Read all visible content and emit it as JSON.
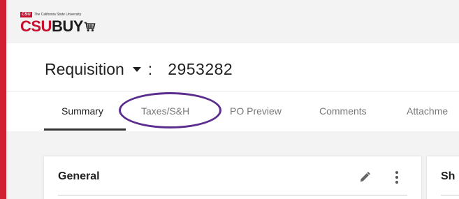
{
  "brand": {
    "badge": "CSU",
    "tagline": "The California State University",
    "name_red": "CSU",
    "name_dark": "BUY",
    "cart_icon": "shopping-cart-icon",
    "accent_color": "#c8102e"
  },
  "header": {
    "doc_type": "Requisition",
    "separator": ":",
    "doc_number": "2953282"
  },
  "tabs": [
    {
      "label": "Summary",
      "active": true
    },
    {
      "label": "Taxes/S&H",
      "active": false,
      "highlighted": true,
      "highlight_color": "#5b2d8e"
    },
    {
      "label": "PO Preview",
      "active": false
    },
    {
      "label": "Comments",
      "active": false
    },
    {
      "label": "Attachme",
      "active": false
    }
  ],
  "cards": [
    {
      "title": "General",
      "actions": [
        "pencil-icon",
        "kebab-menu-icon"
      ]
    },
    {
      "title": "Sh"
    }
  ]
}
